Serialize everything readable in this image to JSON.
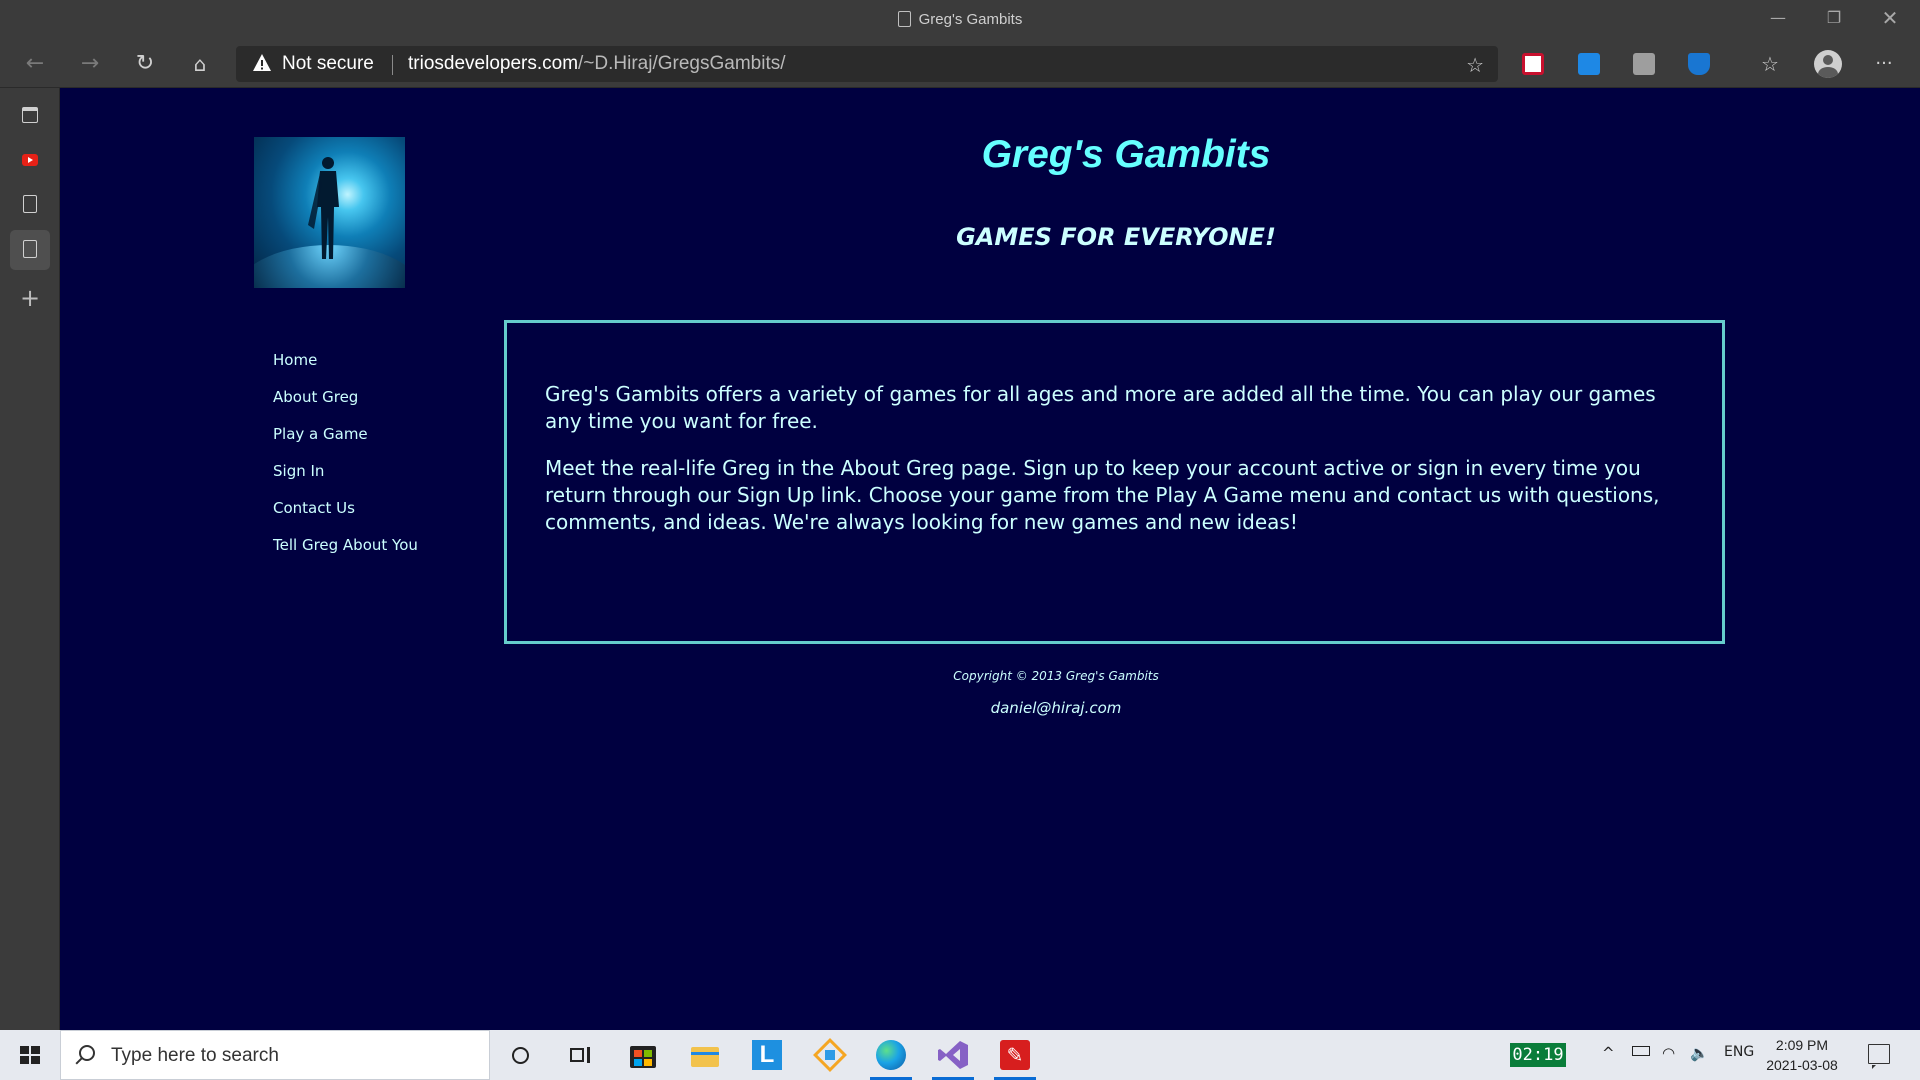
{
  "browser": {
    "window_title": "Greg's Gambits",
    "address": {
      "security_label": "Not secure",
      "domain": "triosdevelopers.com",
      "path": "/~D.Hiraj/GregsGambits/"
    }
  },
  "site": {
    "title": "Greg's Gambits",
    "tagline": "GAMES FOR EVERYONE!",
    "nav": [
      {
        "label": "Home"
      },
      {
        "label": "About Greg"
      },
      {
        "label": "Play a Game"
      },
      {
        "label": "Sign In"
      },
      {
        "label": "Contact Us"
      },
      {
        "label": "Tell Greg About You"
      }
    ],
    "content": {
      "paragraphs": [
        "Greg's Gambits offers a variety of games for all ages and more are added all the time. You can play our games any time you want for free.",
        "Meet the real-life Greg in the About Greg page. Sign up to keep your account active or sign in every time you return through our Sign Up link. Choose your game from the Play A Game menu and contact us with questions, comments, and ideas. We're always looking for new games and new ideas!"
      ]
    },
    "footer": {
      "copyright": "Copyright © 2013 Greg's Gambits",
      "email": "daniel@hiraj.com"
    }
  },
  "taskbar": {
    "search_placeholder": "Type here to search",
    "timer": "02:19",
    "language": "ENG",
    "time": "2:09 PM",
    "date": "2021-03-08"
  },
  "colors": {
    "page_background": "#000040",
    "title": "#66ffff",
    "text": "#ccffff",
    "content_border": "#66cccc"
  }
}
